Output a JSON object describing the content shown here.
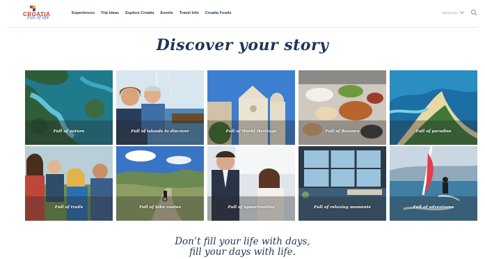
{
  "brand": {
    "wordmark": "CROATIA",
    "tagline": "Full of life",
    "colors": {
      "red": "#e0342b",
      "blue": "#1e5aa8",
      "yellow": "#f2b400",
      "navy": "#1d3557"
    }
  },
  "nav": {
    "items": [
      "Experiences",
      "Trip Ideas",
      "Explore Croatia",
      "Events",
      "Travel Info",
      "Croatia Foods"
    ]
  },
  "header_right": {
    "language": "ENGLISH",
    "icons": [
      "chevron-down-icon",
      "search-icon"
    ]
  },
  "main": {
    "title": "Discover your story",
    "tiles": [
      {
        "label": "Full of nature",
        "scene": "aerial river lakes"
      },
      {
        "label": "Full of islands to discover",
        "scene": "couple sailing"
      },
      {
        "label": "Full of World Heritage",
        "scene": "cathedral"
      },
      {
        "label": "Full of flavours",
        "scene": "food table"
      },
      {
        "label": "Full of paradise",
        "scene": "beach spit"
      },
      {
        "label": "Full of trails",
        "scene": "hiking family"
      },
      {
        "label": "Full of bike routes",
        "scene": "cyclist hills"
      },
      {
        "label": "Full of opportunities",
        "scene": "business people"
      },
      {
        "label": "Full of relaxing moments",
        "scene": "spa pool"
      },
      {
        "label": "Full of adventures",
        "scene": "kitesurfer"
      }
    ]
  },
  "footer": {
    "tagline_line1": "Don’t fill your life with days,",
    "tagline_line2": "fill your days with life."
  }
}
